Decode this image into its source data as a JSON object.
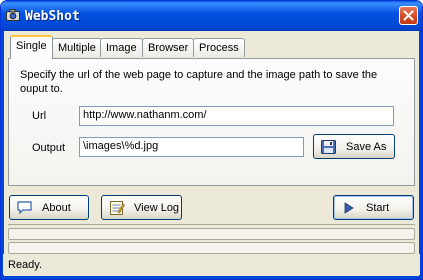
{
  "window": {
    "title": "WebShot"
  },
  "tabs": [
    {
      "label": "Single",
      "active": true
    },
    {
      "label": "Multiple",
      "active": false
    },
    {
      "label": "Image",
      "active": false
    },
    {
      "label": "Browser",
      "active": false
    },
    {
      "label": "Process",
      "active": false
    }
  ],
  "single": {
    "description": "Specify the url of the web page to capture and the image path to save the ouput to.",
    "url_label": "Url",
    "url_value": "http://www.nathanm.com/",
    "output_label": "Output",
    "output_value": "\\images\\%d.jpg",
    "save_as_label": "Save As"
  },
  "buttons": {
    "about_label": "About",
    "view_log_label": "View Log",
    "start_label": "Start"
  },
  "progress": {
    "bar1": 0,
    "bar2": 0
  },
  "status": {
    "text": "Ready."
  },
  "icons": {
    "app": "camera-icon",
    "close": "close-icon",
    "save": "floppy-disk-icon",
    "about": "speech-bubble-icon",
    "view_log": "notepad-icon",
    "start": "play-icon"
  },
  "colors": {
    "titlebar": "#0054e3",
    "window_bg": "#ece9d8",
    "tab_highlight": "#ffc83c"
  }
}
